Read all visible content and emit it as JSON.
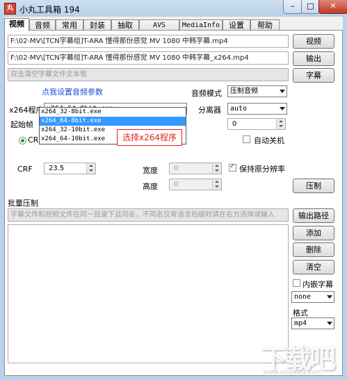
{
  "window": {
    "title": "小丸工具箱 194",
    "icon_text": "丸",
    "controls": {
      "minimize": "–",
      "maximize": "□",
      "close": "✕"
    }
  },
  "tabs": [
    "视频",
    "音频",
    "常用",
    "封装",
    "抽取",
    "AVS",
    "MediaInfo",
    "设置",
    "帮助"
  ],
  "active_tab": "视频",
  "video": {
    "video_path": "F:\\02-MV\\[TCN字幕组]T-ARA 懂得那份感觉 MV 1080 中韩字幕.mp4",
    "output_path": "F:\\02-MV\\[TCN字幕组]T-ARA 懂得那份感觉 MV 1080 中韩字幕_x264.mp4",
    "subtitle_placeholder": "双击清空字幕文件文本框",
    "btn_video": "视频",
    "btn_output": "输出",
    "btn_subtitle": "字幕",
    "audio_params_link": "点我设置音频参数",
    "audio_mode_label": "音频模式",
    "audio_mode_value": "压制音频",
    "x264_label": "x264程序",
    "x264_value": "x264_64-8bit.exe",
    "x264_options": [
      "x264_32-8bit.exe",
      "x264_64-8bit.exe",
      "x264_32-10bit.exe",
      "x264_64-10bit.exe"
    ],
    "x264_selected_index": 1,
    "splitter_label": "分离器",
    "splitter_value": "auto",
    "start_frame_label": "起始帧",
    "start_frame_value": "0",
    "crf_radio_label": "CRF",
    "auto_shutdown_label": "自动关机",
    "auto_shutdown_checked": false,
    "crf_label": "CRF",
    "crf_value": "23.5",
    "width_label": "宽度",
    "width_value": "0",
    "height_label": "高度",
    "height_value": "0",
    "keep_res_label": "保持原分辨率",
    "keep_res_checked": true,
    "btn_encode": "压制"
  },
  "batch": {
    "title": "批量压制",
    "hint": "字幕文件和视频文件在同一目录下且同名，不同名仅有语言后缀时请在右方选择或输入",
    "btn_output_path": "输出路径",
    "btn_add": "添加",
    "btn_delete": "删除",
    "btn_clear": "清空",
    "embed_sub_label": "内嵌字幕",
    "embed_sub_checked": false,
    "lang_value": "none",
    "format_label": "格式",
    "format_value": "mp4"
  },
  "annotation": "选择x264程序",
  "watermark": {
    "text": "下载吧",
    "url": "www.xiazaiba.com"
  }
}
